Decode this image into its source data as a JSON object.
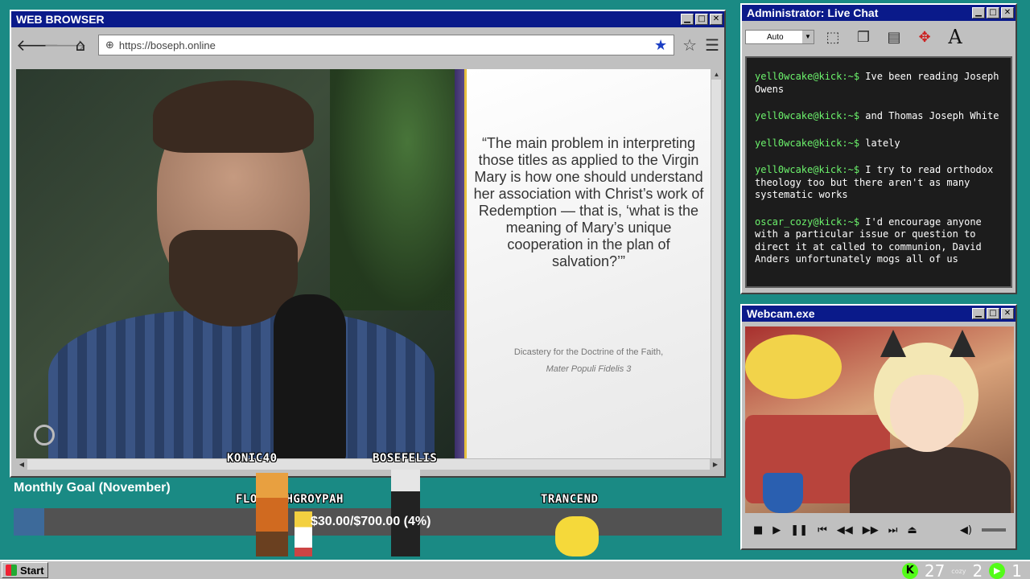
{
  "browser": {
    "title": "WEB BROWSER",
    "url": "https://boseph.online",
    "quote": "“The main problem in interpreting those titles as applied to the Virgin Mary is how one should understand her association with Christ’s work of Redemption — that is, ‘what is the meaning of Mary’s unique cooperation in the plan of salvation?’”",
    "citation_line1": "Dicastery for the Doctrine of the Faith,",
    "citation_line2": "Mater Populi Fidelis 3"
  },
  "chat": {
    "title": "Administrator: Live Chat",
    "font_size_select": "Auto",
    "messages": [
      {
        "user": "yell0wcake@kick:~$",
        "text": "Ive been reading Joseph Owens"
      },
      {
        "user": "yell0wcake@kick:~$",
        "text": "and Thomas Joseph White"
      },
      {
        "user": "yell0wcake@kick:~$",
        "text": "lately"
      },
      {
        "user": "yell0wcake@kick:~$",
        "text": "I try to read orthodox theology too but there aren't as many systematic works"
      },
      {
        "user": "oscar_cozy@kick:~$",
        "text": "I'd encourage anyone with a particular issue or question to direct it at called to communion, David Anders unfortunately mogs all of us"
      }
    ]
  },
  "webcam": {
    "title": "Webcam.exe"
  },
  "goal": {
    "label": "Monthly Goal (November)",
    "text": "$30.00/$700.00 (4%)",
    "fraction": 0.043
  },
  "sprites": {
    "name1": "KONIC40",
    "name2": "BOSEFELIS",
    "name3": "FLORIDAHGROYPAH",
    "name4": "TRANCEND"
  },
  "taskbar": {
    "start": "Start",
    "kick_count": "27",
    "cozy_label": "cozy",
    "second_count": "2",
    "third_count": "1"
  },
  "icons": [
    "back-icon",
    "forward-icon",
    "home-icon",
    "globe-icon",
    "bookmark-star-icon",
    "favorite-icon",
    "menu-icon"
  ]
}
